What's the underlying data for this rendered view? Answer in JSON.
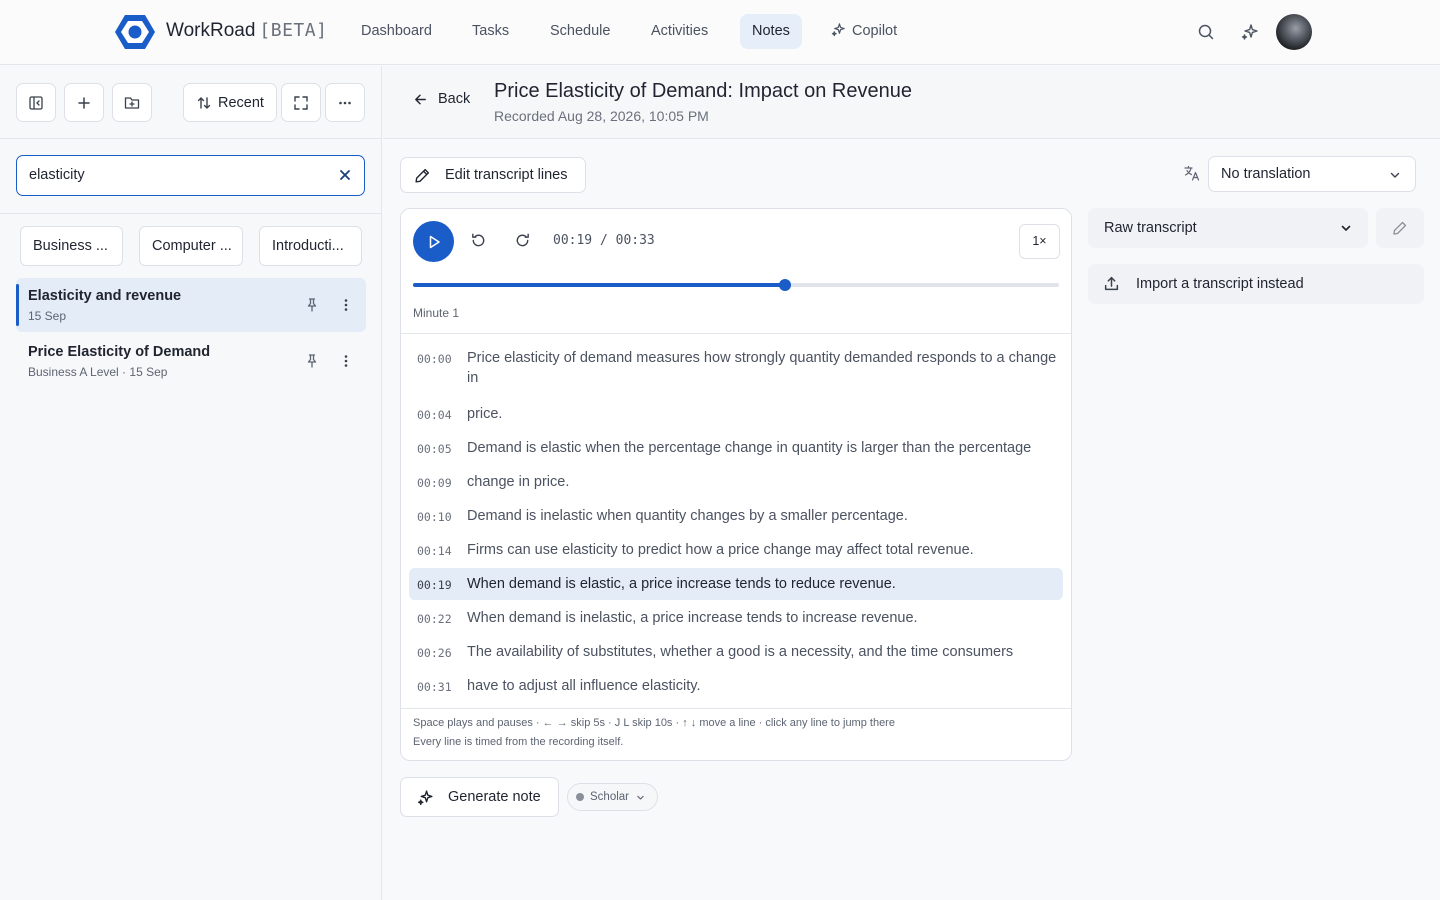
{
  "app": {
    "name": "WorkRoad",
    "badge": "[BETA]"
  },
  "nav": {
    "tabs": [
      {
        "label": "Dashboard"
      },
      {
        "label": "Tasks"
      },
      {
        "label": "Schedule"
      },
      {
        "label": "Activities"
      },
      {
        "label": "Notes",
        "active": true
      },
      {
        "label": "Copilot",
        "icon": "sparkle-icon"
      }
    ],
    "icons": [
      "search-icon",
      "sparkle-icon",
      "avatar"
    ]
  },
  "sidebar": {
    "toolbar": {
      "icons": [
        "collapse-sidebar-icon",
        "plus-icon",
        "folder-plus-icon",
        "sort-icon",
        "expand-icon",
        "more-icon"
      ],
      "sort_label": "Recent"
    },
    "search": {
      "value": "elasticity",
      "clear_icon": "close-icon"
    },
    "chips": [
      "Business ...",
      "Computer ...",
      "Introducti..."
    ],
    "notes": [
      {
        "title": "Elasticity and revenue",
        "subtitle": "15 Sep",
        "active": true
      },
      {
        "title": "Price Elasticity of Demand",
        "subtitle": "Business A Level · 15 Sep",
        "active": false
      }
    ]
  },
  "main": {
    "back_label": "Back",
    "title": "Price Elasticity of Demand: Impact on Revenue",
    "recorded": "Recorded Aug 28, 2026, 10:05 PM",
    "edit_label": "Edit transcript lines",
    "translation": "No translation",
    "player": {
      "time": "00:19 / 00:33",
      "speed": "1×",
      "progress_fraction": 0.576,
      "minute_label": "Minute 1",
      "accent": "#1a5cc8"
    },
    "lines": [
      {
        "ts": "00:00",
        "text": "Price elasticity of demand measures how strongly quantity demanded responds to a change in",
        "active": false
      },
      {
        "ts": "00:04",
        "text": "price.",
        "active": false
      },
      {
        "ts": "00:05",
        "text": "Demand is elastic when the percentage change in quantity is larger than the percentage",
        "active": false
      },
      {
        "ts": "00:09",
        "text": "change in price.",
        "active": false
      },
      {
        "ts": "00:10",
        "text": "Demand is inelastic when quantity changes by a smaller percentage.",
        "active": false
      },
      {
        "ts": "00:14",
        "text": "Firms can use elasticity to predict how a price change may affect total revenue.",
        "active": false
      },
      {
        "ts": "00:19",
        "text": "When demand is elastic, a price increase tends to reduce revenue.",
        "active": true
      },
      {
        "ts": "00:22",
        "text": "When demand is inelastic, a price increase tends to increase revenue.",
        "active": false
      },
      {
        "ts": "00:26",
        "text": "The availability of substitutes, whether a good is a necessity, and the time consumers",
        "active": false
      },
      {
        "ts": "00:31",
        "text": "have to adjust all influence elasticity.",
        "active": false
      }
    ],
    "hint_keys": "Space plays and pauses · ← → skip 5s · J L skip 10s · ↑ ↓ move a line · click any line to jump there",
    "hint_timing": "Every line is timed from the recording itself.",
    "transcript_mode": "Raw transcript",
    "import_label": "Import a transcript instead",
    "generate_label": "Generate note",
    "style_label": "Scholar"
  }
}
